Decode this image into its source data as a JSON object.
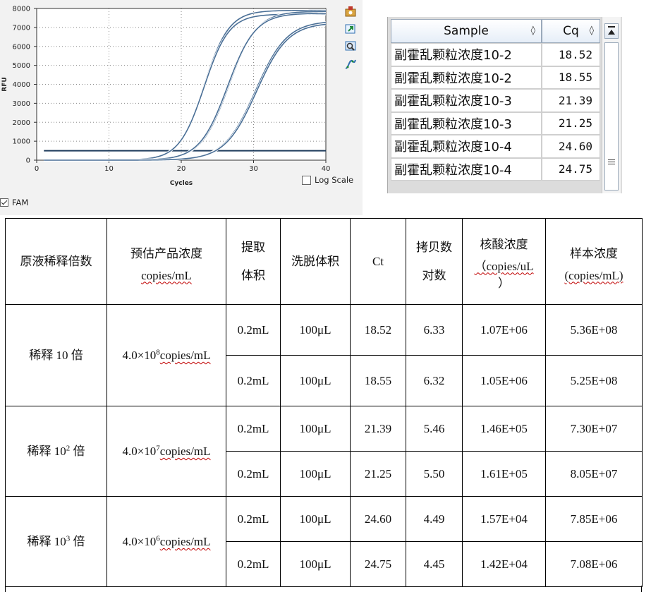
{
  "chart_data": {
    "type": "line",
    "title": "",
    "xlabel": "Cycles",
    "ylabel": "RFU",
    "xlim": [
      0,
      40
    ],
    "ylim": [
      0,
      8000
    ],
    "x_ticks": [
      "0",
      "10",
      "20",
      "30",
      "40"
    ],
    "y_ticks": [
      "0",
      "1000",
      "2000",
      "3000",
      "4000",
      "5000",
      "6000",
      "7000",
      "8000"
    ],
    "grid": true,
    "legend": "none",
    "threshold": 500,
    "series": [
      {
        "cq": 18.52,
        "plateau": 7900,
        "k": 0.58,
        "color": "#4a6f96"
      },
      {
        "cq": 18.55,
        "plateau": 7700,
        "k": 0.58,
        "color": "#4a6f96"
      },
      {
        "cq": 21.39,
        "plateau": 7850,
        "k": 0.52,
        "color": "#4a6f96"
      },
      {
        "cq": 21.25,
        "plateau": 7750,
        "k": 0.52,
        "color": "#4a6f96"
      },
      {
        "cq": 24.6,
        "plateau": 7350,
        "k": 0.46,
        "color": "#4a6f96"
      },
      {
        "cq": 24.75,
        "plateau": 7250,
        "k": 0.46,
        "color": "#4a6f96"
      }
    ],
    "threshold_color": "#1f3b5c"
  },
  "tools": [
    {
      "name": "settings-icon"
    },
    {
      "name": "export-icon"
    },
    {
      "name": "zoom-icon"
    },
    {
      "name": "curve-icon"
    }
  ],
  "log_scale_label": "Log Scale",
  "fam_label": "FAM",
  "sample_grid": {
    "headers": {
      "sample": "Sample",
      "cq": "Cq",
      "sort_glyph": "◊"
    },
    "rows": [
      {
        "sample": "副霍乱颗粒浓度10-2",
        "cq": "18.52"
      },
      {
        "sample": "副霍乱颗粒浓度10-2",
        "cq": "18.55"
      },
      {
        "sample": "副霍乱颗粒浓度10-3",
        "cq": "21.39"
      },
      {
        "sample": "副霍乱颗粒浓度10-3",
        "cq": "21.25"
      },
      {
        "sample": "副霍乱颗粒浓度10-4",
        "cq": "24.60"
      },
      {
        "sample": "副霍乱颗粒浓度10-4",
        "cq": "24.75"
      }
    ]
  },
  "table": {
    "headers": {
      "dilution": "原液稀释倍数",
      "est_1": "预估产品浓度",
      "est_2": "copies/mL",
      "extract_1": "提取",
      "extract_2": "体积",
      "elution": "洗脱体积",
      "ct": "Ct",
      "copy_1": "拷贝数",
      "copy_2": "对数",
      "nucleic_1": "核酸浓度",
      "nucleic_2": "（copies/uL",
      "nucleic_3": "）",
      "sample_1": "样本浓度",
      "sample_2": "(copies/mL)"
    },
    "groups": [
      {
        "dilution_prefix": "稀释 10",
        "dilution_sup": "",
        "dilution_suffix": " 倍",
        "est_prefix": "4.0×10",
        "est_sup": "8",
        "est_unit": "copies/mL",
        "rows": [
          {
            "extract": "0.2mL",
            "elution": "100μL",
            "ct": "18.52",
            "log": "6.33",
            "nucleic": "1.07E+06",
            "sample": "5.36E+08"
          },
          {
            "extract": "0.2mL",
            "elution": "100μL",
            "ct": "18.55",
            "log": "6.32",
            "nucleic": "1.05E+06",
            "sample": "5.25E+08"
          }
        ]
      },
      {
        "dilution_prefix": "稀释 10",
        "dilution_sup": "2",
        "dilution_suffix": " 倍",
        "est_prefix": "4.0×10",
        "est_sup": "7",
        "est_unit": "copies/mL",
        "rows": [
          {
            "extract": "0.2mL",
            "elution": "100μL",
            "ct": "21.39",
            "log": "5.46",
            "nucleic": "1.46E+05",
            "sample": "7.30E+07"
          },
          {
            "extract": "0.2mL",
            "elution": "100μL",
            "ct": "21.25",
            "log": "5.50",
            "nucleic": "1.61E+05",
            "sample": "8.05E+07"
          }
        ]
      },
      {
        "dilution_prefix": "稀释 10",
        "dilution_sup": "3",
        "dilution_suffix": " 倍",
        "est_prefix": "4.0×10",
        "est_sup": "6",
        "est_unit": "copies/mL",
        "rows": [
          {
            "extract": "0.2mL",
            "elution": "100μL",
            "ct": "24.60",
            "log": "4.49",
            "nucleic": "1.57E+04",
            "sample": "7.85E+06"
          },
          {
            "extract": "0.2mL",
            "elution": "100μL",
            "ct": "24.75",
            "log": "4.45",
            "nucleic": "1.42E+04",
            "sample": "7.08E+06"
          }
        ]
      }
    ]
  }
}
